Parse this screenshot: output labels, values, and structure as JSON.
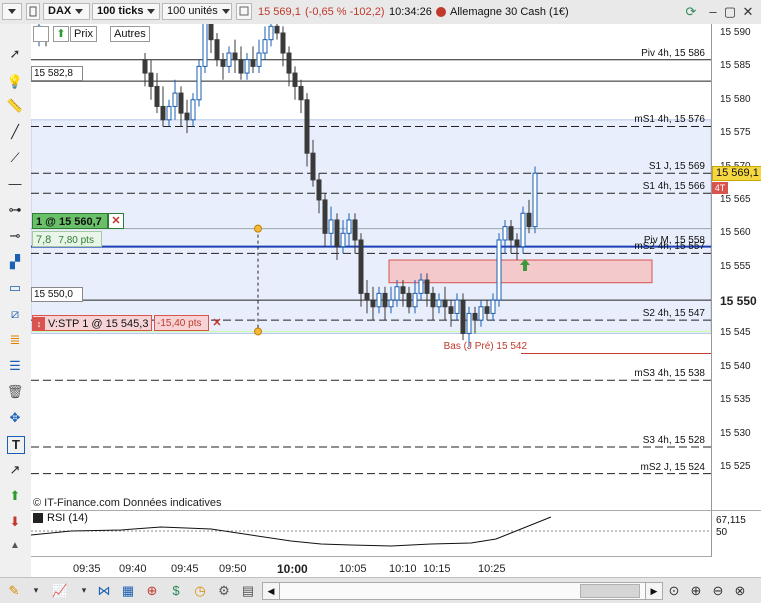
{
  "toolbar": {
    "instrument": "DAX",
    "period": "100 ticks",
    "units": "100 unités",
    "price": "15 569,1",
    "change": "(-0,65 % -102,2)",
    "time": "10:34:26",
    "market": "Allemagne 30 Cash (1€)",
    "tab_price": "Prix",
    "tab_other": "Autres"
  },
  "chart": {
    "levels": [
      {
        "label": "Piv 4h, 15 586",
        "value": 15586,
        "style": "solid"
      },
      {
        "label": "mS1 4h, 15 576",
        "value": 15576,
        "style": "dashed"
      },
      {
        "label": "S1 J, 15 569",
        "value": 15569,
        "style": "dashed"
      },
      {
        "label": "S1 4h, 15 566",
        "value": 15566,
        "style": "dashed"
      },
      {
        "label": "Piv M, 15 558",
        "value": 15558,
        "style": "solid"
      },
      {
        "label": "mS2 4h, 15 557",
        "value": 15557,
        "style": "dashed"
      },
      {
        "label": "S2 4h, 15 547",
        "value": 15547,
        "style": "dashed"
      },
      {
        "label": "Bas (J Pré) 15 542",
        "value": 15542,
        "style": "red"
      },
      {
        "label": "mS3 4h, 15 538",
        "value": 15538,
        "style": "dashed"
      },
      {
        "label": "S3 4h, 15 528",
        "value": 15528,
        "style": "dashed"
      },
      {
        "label": "mS2 J, 15 524",
        "value": 15524,
        "style": "dashed"
      }
    ],
    "ref_lines": [
      {
        "label": "15 582,8",
        "value": 15582.8
      },
      {
        "label": "15 550,0",
        "value": 15550.0
      }
    ],
    "position": {
      "qty_price": "1 @ 15 560,7",
      "pnl": "7,8",
      "pnl_pts": "7,80 pts"
    },
    "stop": {
      "label": "V:STP  1 @ 15 545,3",
      "pts": "-15,40 pts"
    },
    "price_tag": "15 569,1",
    "price_tag_sub": "4T",
    "credit": "© IT-Finance.com  Données indicatives",
    "yticks": [
      "15 590",
      "15 585",
      "15 580",
      "15 575",
      "15 570",
      "15 565",
      "15 560",
      "15 555",
      "15 550",
      "15 545",
      "15 540",
      "15 535",
      "15 530",
      "15 525"
    ],
    "ytick_values": [
      15590,
      15585,
      15580,
      15575,
      15570,
      15565,
      15560,
      15555,
      15550,
      15545,
      15540,
      15535,
      15530,
      15525
    ],
    "bold_tick": "15 550"
  },
  "rsi": {
    "label": "RSI (14)",
    "value": "67,115",
    "tick": "50"
  },
  "xaxis": {
    "ticks": [
      "09:35",
      "09:40",
      "09:45",
      "09:50",
      "10:00",
      "10:05",
      "10:10",
      "10:15",
      "10:25"
    ]
  },
  "colors": {
    "up": "#1a5fb4",
    "down": "#3a3a3a",
    "zone_fill": "#e8eefc",
    "red_box": "#f4c9cc",
    "accent_red": "#d9534f",
    "green": "#3c9a3c",
    "price_tag": "#f5d742"
  }
}
